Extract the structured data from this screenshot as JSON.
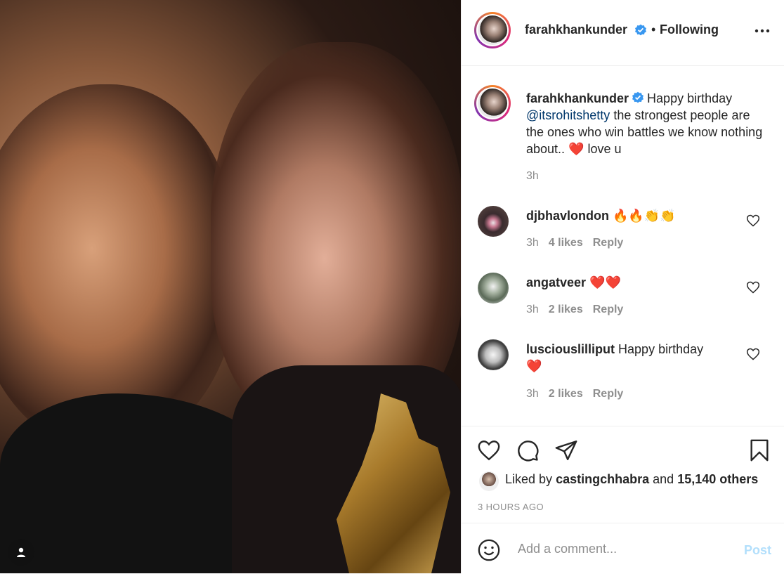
{
  "post": {
    "image_alt_tag_icon": "user-icon"
  },
  "header": {
    "username": "farahkhankunder",
    "separator": "•",
    "follow_state": "Following",
    "more_icon": "more-horizontal-icon"
  },
  "caption": {
    "username": "farahkhankunder",
    "text_before": "Happy birthday",
    "mention": "@itsrohitshetty",
    "text_after": "the strongest people are the ones who win battles we know nothing about..",
    "emoji": "❤️",
    "text_end": "love u",
    "time": "3h"
  },
  "comments": [
    {
      "username": "djbhavlondon",
      "text": "🔥🔥👏👏",
      "time": "3h",
      "likes": "4 likes",
      "reply": "Reply"
    },
    {
      "username": "angatveer",
      "text": "❤️❤️",
      "time": "3h",
      "likes": "2 likes",
      "reply": "Reply"
    },
    {
      "username": "lusciouslilliput",
      "text": "Happy birthday",
      "emoji": "❤️",
      "time": "3h",
      "likes": "2 likes",
      "reply": "Reply"
    }
  ],
  "actions": {
    "like_icon": "heart-icon",
    "comment_icon": "comment-icon",
    "share_icon": "send-icon",
    "save_icon": "bookmark-icon"
  },
  "likes": {
    "prefix": "Liked by",
    "user": "castingchhabra",
    "mid": "and",
    "count": "15,140 others"
  },
  "timestamp": "3 HOURS AGO",
  "add_comment": {
    "placeholder": "Add a comment...",
    "post_label": "Post",
    "emoji_icon": "smiley-icon"
  },
  "colors": {
    "verified": "#3897f0",
    "mention": "#00376b",
    "post_disabled": "#b2dffc",
    "heart": "#e0001b"
  }
}
